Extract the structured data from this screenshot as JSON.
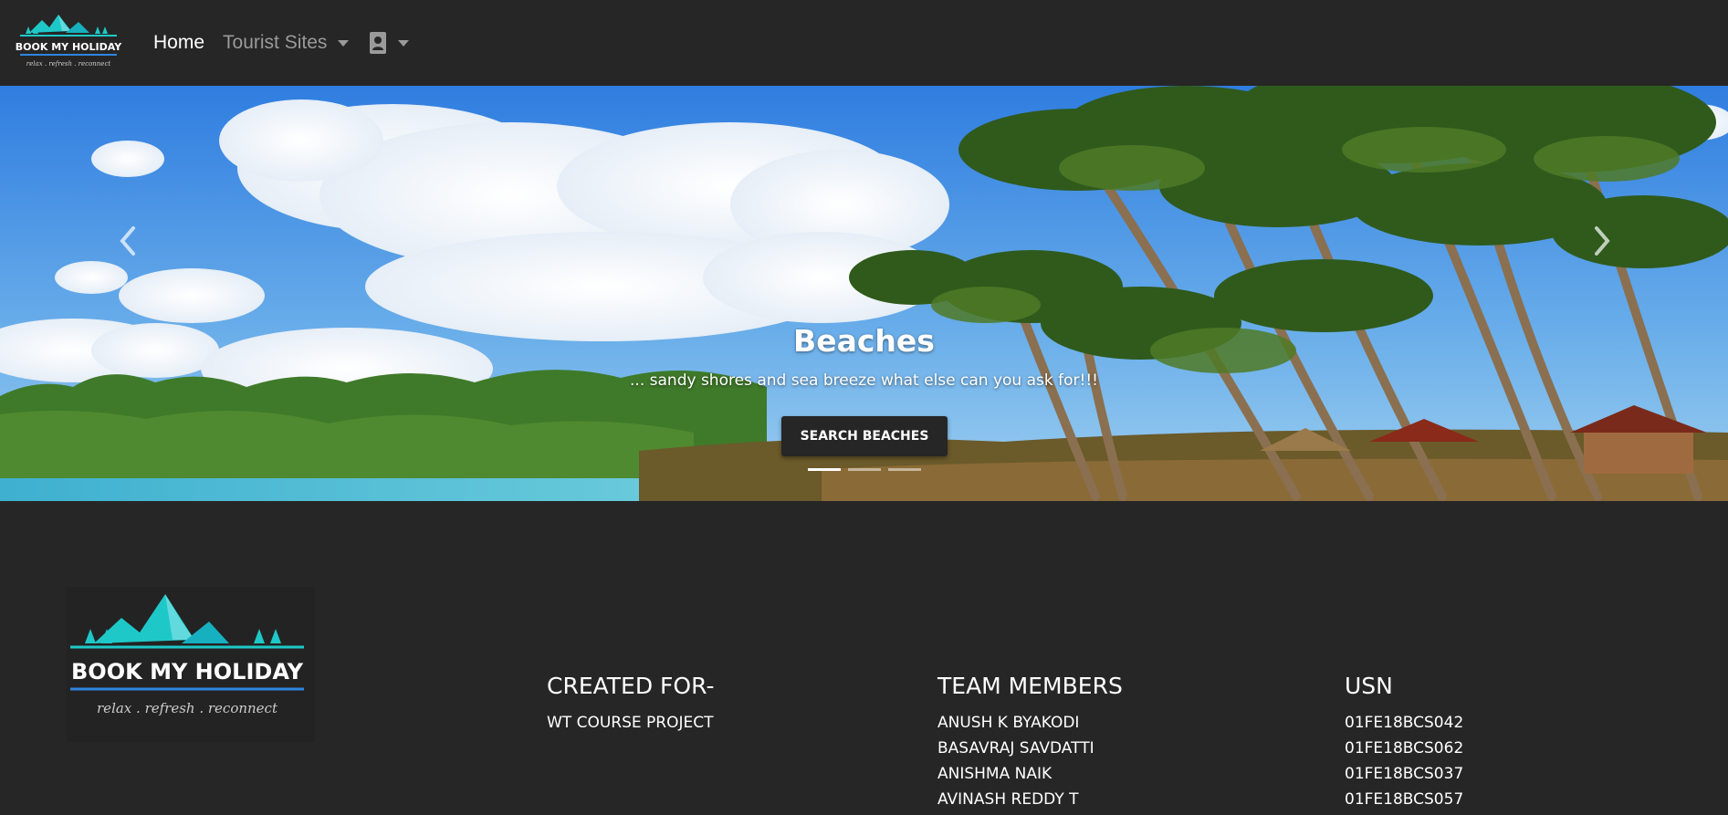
{
  "logo": {
    "brand_text": "BOOK MY HOLIDAY",
    "tagline": "relax . refresh . reconnect"
  },
  "nav": {
    "home": "Home",
    "tourist_sites": "Tourist Sites"
  },
  "carousel": {
    "title": "Beaches",
    "subtitle": "... sandy shores and sea breeze what else can you ask for!!!",
    "button": "SEARCH BEACHES",
    "slide_count": 3,
    "active_slide": 1
  },
  "footer": {
    "created": {
      "heading": "CREATED FOR-",
      "lines": [
        "WT COURSE PROJECT"
      ]
    },
    "team": {
      "heading": "TEAM MEMBERS",
      "members": [
        "ANUSH K BYAKODI",
        "BASAVRAJ SAVDATTI",
        "ANISHMA NAIK",
        "AVINASH REDDY T"
      ]
    },
    "usn": {
      "heading": "USN",
      "values": [
        "01FE18BCS042",
        "01FE18BCS062",
        "01FE18BCS037",
        "01FE18BCS057"
      ]
    }
  },
  "colors": {
    "background": "#262626",
    "logo_teal": "#1fc8c8",
    "logo_blue": "#2e86de"
  }
}
